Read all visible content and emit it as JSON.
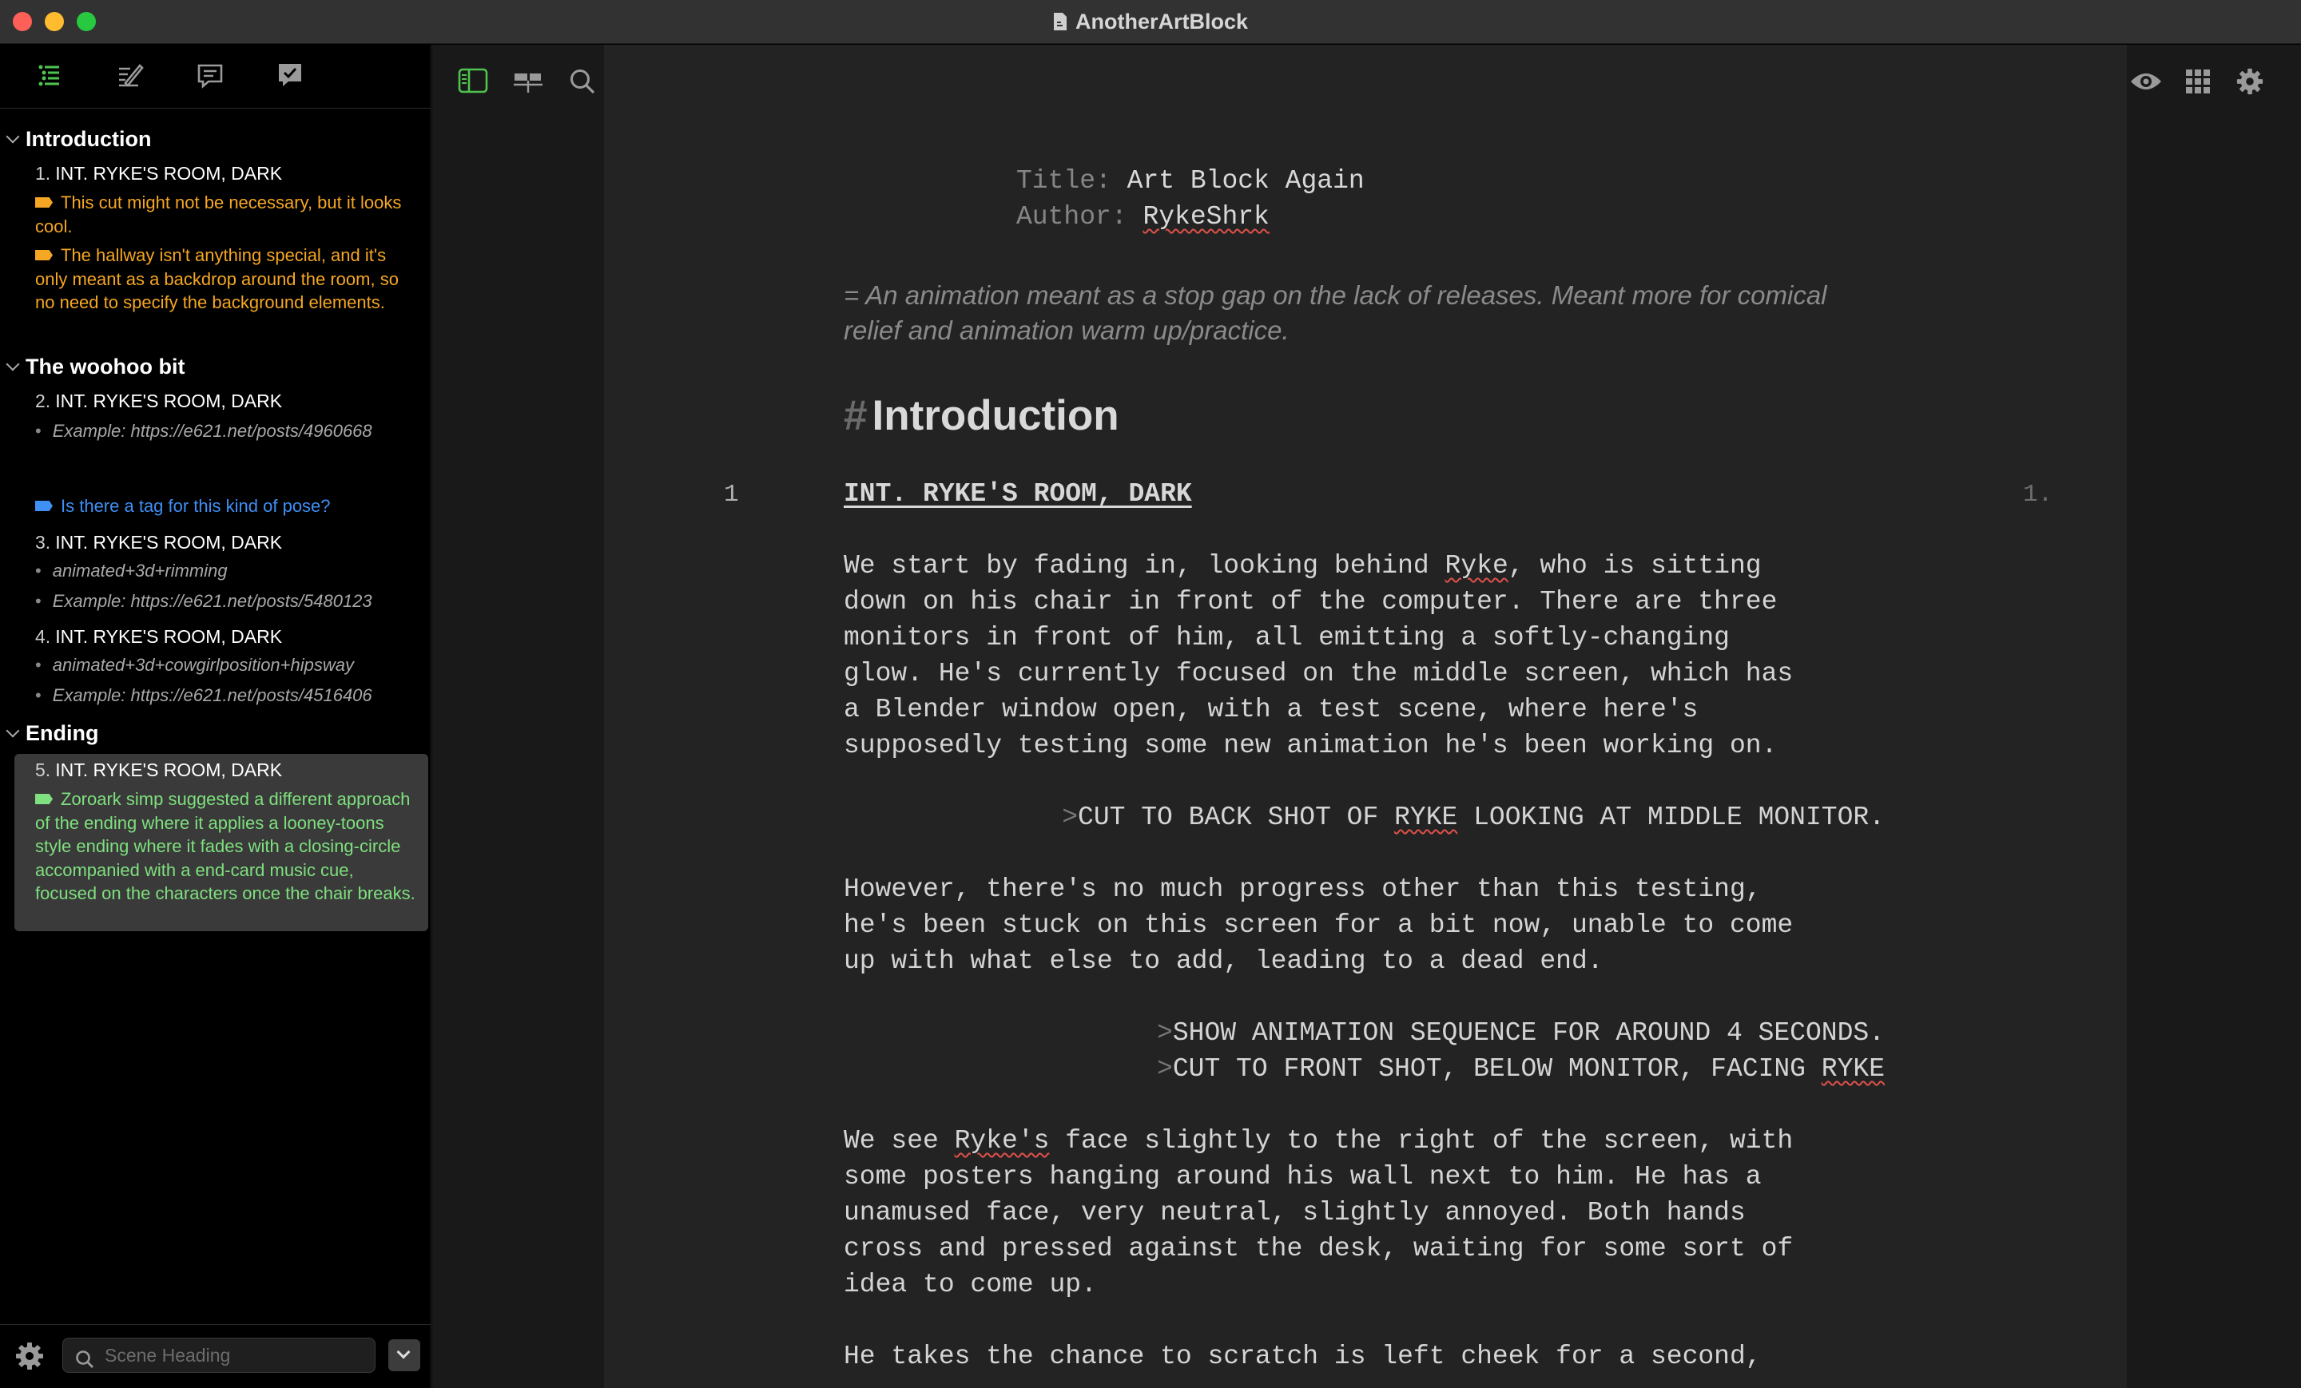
{
  "window": {
    "title": "AnotherArtBlock"
  },
  "sidebar": {
    "sections": [
      {
        "title": "Introduction"
      },
      {
        "title": "The woohoo bit"
      },
      {
        "title": "Ending"
      }
    ],
    "scenes": [
      {
        "num": "1.",
        "title": "INT. RYKE'S ROOM, DARK"
      },
      {
        "num": "2.",
        "title": "INT. RYKE'S ROOM, DARK"
      },
      {
        "num": "3.",
        "title": "INT. RYKE'S ROOM, DARK"
      },
      {
        "num": "4.",
        "title": "INT. RYKE'S ROOM, DARK"
      },
      {
        "num": "5.",
        "title": "INT. RYKE'S ROOM, DARK"
      }
    ],
    "notes": {
      "n1": "This cut might not be necessary, but it looks cool.",
      "n2": "The hallway isn't anything special, and it's only meant as a backdrop around the room, so no need to specify the background elements.",
      "n3": "Is there a tag for this kind of pose?",
      "n4": "Zoroark simp suggested a different approach of the ending where it applies a looney-toons style ending where it fades with a closing-circle accompanied with a end-card music cue, focused on the characters once the chair breaks."
    },
    "synopses": {
      "s1": "Example: https://e621.net/posts/4960668",
      "s2": "animated+3d+rimming",
      "s3": "Example: https://e621.net/posts/5480123",
      "s4": "animated+3d+cowgirlposition+hipsway",
      "s5": "Example: https://e621.net/posts/4516406"
    },
    "search": {
      "placeholder": "Scene Heading"
    }
  },
  "editor": {
    "title_page": {
      "title_key": "Title:",
      "title_value": "Art Block Again",
      "author_key": "Author:",
      "author_value": "RykeShrk"
    },
    "synopsis": "= An animation meant as a stop gap on the lack of releases. Meant more for comical relief and animation warm up/practice.",
    "section_heading": {
      "hash": "#",
      "text": "Introduction"
    },
    "scene": {
      "number_left": "1",
      "number_right": "1.",
      "heading": "INT. RYKE'S ROOM, DARK"
    },
    "action1": [
      "We start by fading in, looking behind ",
      "Ryke",
      ", who is sitting",
      "down on his chair in front of the computer. There are three",
      "monitors in front of him, all emitting a softly-changing",
      "glow. He's currently focused on the middle screen, which has",
      "a Blender window open, with a test scene, where here's",
      "supposedly testing some new animation he's been working on."
    ],
    "transition1": {
      "gt": ">",
      "pre": "CUT TO BACK SHOT OF ",
      "name": "RYKE",
      "post": " LOOKING AT MIDDLE MONITOR."
    },
    "action2": [
      "However, there's no much progress other than this testing,",
      "he's been stuck on this screen for a bit now, unable to come",
      "up with what else to add, leading to a dead end."
    ],
    "transition2": {
      "gt": ">",
      "text": "SHOW ANIMATION SEQUENCE FOR AROUND 4 SECONDS."
    },
    "transition3": {
      "gt": ">",
      "pre": "CUT TO FRONT SHOT, BELOW MONITOR, FACING ",
      "name": "RYKE"
    },
    "action3": [
      "We see ",
      "Ryke's",
      " face slightly to the right of the screen, with",
      "some posters hanging around his wall next to him. He has a",
      "unamused face, very neutral, slightly annoyed. Both hands",
      "cross and pressed against the desk, waiting for some sort of",
      "idea to come up."
    ],
    "action4": "He takes the chance to scratch is left cheek for a second,"
  },
  "colors": {
    "accent_green": "#7ee07e",
    "note_orange": "#f5a623",
    "note_blue": "#3f8ff4"
  }
}
